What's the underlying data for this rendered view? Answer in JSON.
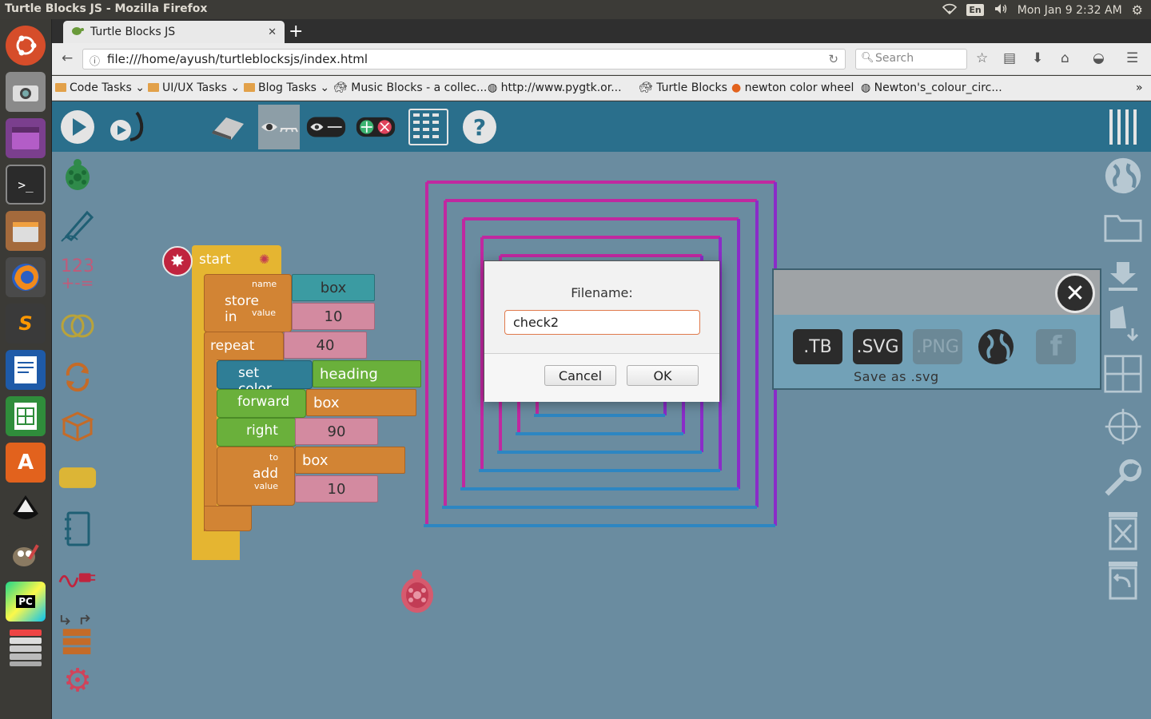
{
  "system": {
    "window_title": "Turtle Blocks JS - Mozilla Firefox",
    "keyboard_layout": "En",
    "clock": "Mon Jan  9  2:32 AM"
  },
  "launcher": {
    "icons": [
      "ubuntu-dash",
      "camera-app",
      "purple-window",
      "terminal",
      "files",
      "firefox",
      "sublime-text",
      "writer",
      "calc",
      "software-center",
      "inkscape",
      "gimp",
      "pycharm",
      "steam-like",
      "workspaces"
    ]
  },
  "browser": {
    "tab_title": "Turtle Blocks JS",
    "tab_close": "✕",
    "new_tab": "+",
    "url": "file:///home/ayush/turtleblocksjs/index.html",
    "search_placeholder": "Search",
    "bookmarks": [
      "Code Tasks",
      "UI/UX Tasks",
      "Blog Tasks",
      "Music Blocks - a collec...",
      "http://www.pygtk.or...",
      "Turtle Blocks",
      "newton color wheel",
      "Newton's_colour_circ..."
    ]
  },
  "palette": {
    "numbers_icon_text": "123",
    "numbers_icon_ops": "+-="
  },
  "blocks": {
    "start": "start",
    "store_in": "store in",
    "name_label": "name",
    "value_label": "value",
    "store_name": "box",
    "store_value": "10",
    "repeat": "repeat",
    "repeat_count": "40",
    "set_color": "set color",
    "set_color_arg": "heading",
    "forward": "forward",
    "forward_arg": "box",
    "right": "right",
    "right_arg": "90",
    "add": "add",
    "to_label": "to",
    "add_value_label": "value",
    "add_to": "box",
    "add_value": "10"
  },
  "dialog": {
    "title": "Filename:",
    "filename_value": "check2",
    "cancel": "Cancel",
    "ok": "OK"
  },
  "save_panel": {
    "formats": [
      ".TB",
      ".SVG",
      ".PNG"
    ],
    "caption": "Save as .svg"
  },
  "colors": {
    "toolbar": "#2a6f8c",
    "canvas": "#6a8ca0",
    "start_block": "#e5b531",
    "store_block": "#d28434",
    "repeat_block": "#d28434",
    "pen_block": "#2f7e96",
    "action_block": "#6ab03b",
    "number_slot": "#d38aa0",
    "teal_slot": "#3b9ba2",
    "spiral_magenta": "#c028a0",
    "spiral_purple": "#8a2cc8",
    "spiral_blue": "#2d86c2"
  }
}
